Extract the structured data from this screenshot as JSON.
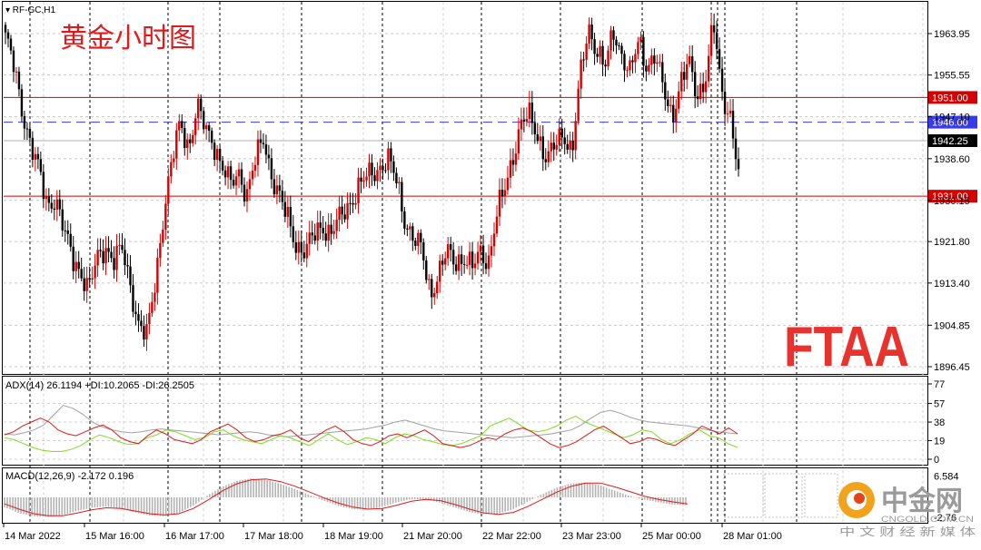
{
  "window": {
    "symbol": "RF-GC,H1",
    "caption": "黄金小时图"
  },
  "watermark": {
    "brand": "FTAA",
    "brand_color": "#e8322e",
    "site_name": "中金网",
    "site_domain": "CNGOLD.COM.CN",
    "site_tagline": "中 文 财 经 新 媒 体"
  },
  "colors": {
    "bull": "#d60000",
    "bear": "#000000",
    "level_line": "#d60000",
    "dashed_line": "#3a3ae6",
    "adx": "#a0a0a0",
    "plus_di": "#7ddc1f",
    "minus_di": "#e0191a",
    "macd_hist": "#b4b4b4",
    "macd_signal": "#e0191a"
  },
  "chart_data": [
    {
      "type": "candlestick",
      "title": "黄金小时图",
      "ylim": [
        1893,
        1971
      ],
      "y_ticks": [
        "1963.95",
        "1955.55",
        "1947.10",
        "1938.60",
        "1930.15",
        "1921.80",
        "1913.40",
        "1904.85",
        "1896.45"
      ],
      "x_ticks": [
        "14 Mar 2022",
        "15 Mar 16:00",
        "16 Mar 17:00",
        "17 Mar 18:00",
        "18 Mar 19:00",
        "21 Mar 20:00",
        "22 Mar 22:00",
        "23 Mar 23:00",
        "25 Mar 00:00",
        "28 Mar 01:00"
      ],
      "price_anchors": [
        1963.5,
        1957,
        1948.5,
        1942,
        1936,
        1929,
        1931,
        1924,
        1918.5,
        1916,
        1912,
        1918,
        1921,
        1918,
        1920,
        1913,
        1905,
        1902.5,
        1914,
        1928,
        1938,
        1946,
        1941,
        1949,
        1944.5,
        1942,
        1937,
        1933,
        1936,
        1931.5,
        1938,
        1943,
        1935,
        1930,
        1926,
        1921,
        1919.5,
        1923,
        1925.5,
        1923,
        1926,
        1929,
        1931.5,
        1934,
        1936,
        1937,
        1938,
        1934,
        1926,
        1922,
        1920,
        1911.5,
        1915,
        1919.5,
        1918,
        1918.5,
        1916,
        1920,
        1918,
        1927,
        1933,
        1940,
        1946,
        1947,
        1943,
        1938.5,
        1941,
        1944,
        1940,
        1955,
        1965,
        1961,
        1957,
        1964,
        1960,
        1956,
        1962,
        1957.5,
        1960,
        1952,
        1947,
        1954,
        1958,
        1951,
        1955,
        1966,
        1951,
        1948,
        1936
      ],
      "levels": [
        {
          "label": "1951.00",
          "value": 1951.0,
          "style": "solid",
          "color": "#d60000"
        },
        {
          "label": "1946.00",
          "value": 1946.0,
          "style": "dashed",
          "color": "#3a3ae6"
        },
        {
          "label": "1942.25",
          "value": 1942.25,
          "style": "current",
          "color": "#000000"
        },
        {
          "label": "1931.00",
          "value": 1931.0,
          "style": "solid",
          "color": "#d60000"
        }
      ]
    },
    {
      "type": "line",
      "indicator": "ADX(14)",
      "title": "ADX(14) 26.1194 +DI:10.2065 -DI:26.2505",
      "ylim": [
        0,
        77
      ],
      "y_ticks": [
        "77",
        "57",
        "38",
        "19",
        "0"
      ],
      "series": [
        {
          "name": "ADX",
          "last": 26.1194,
          "values": [
            26,
            25,
            27,
            30,
            35,
            45,
            55,
            52,
            46,
            38,
            33,
            30,
            28,
            27,
            28,
            30,
            31,
            30,
            29,
            28,
            27,
            26,
            25,
            26,
            27,
            28,
            27,
            25,
            24,
            23,
            24,
            25,
            26,
            27,
            28,
            29,
            30,
            31,
            33,
            35,
            38,
            40,
            37,
            34,
            31,
            29,
            28,
            27,
            26,
            25,
            24,
            23,
            22,
            23,
            24,
            25,
            26,
            28,
            30,
            35,
            42,
            48,
            50,
            47,
            43,
            40,
            38,
            37,
            36,
            35,
            34,
            32,
            30,
            28,
            27,
            26
          ]
        },
        {
          "name": "+DI",
          "last": 10.2065,
          "values": [
            22,
            20,
            16,
            12,
            9,
            8,
            8,
            10,
            14,
            20,
            25,
            22,
            18,
            15,
            16,
            22,
            25,
            30,
            28,
            24,
            20,
            22,
            28,
            30,
            24,
            20,
            18,
            16,
            20,
            24,
            22,
            18,
            14,
            20,
            26,
            20,
            15,
            18,
            22,
            20,
            16,
            22,
            26,
            24,
            20,
            18,
            15,
            14,
            16,
            20,
            24,
            34,
            38,
            42,
            36,
            30,
            28,
            30,
            34,
            40,
            44,
            38,
            34,
            30,
            26,
            22,
            25,
            30,
            28,
            20,
            16,
            20,
            26,
            30,
            24,
            22,
            16,
            12
          ]
        },
        {
          "name": "-DI",
          "last": 26.2505,
          "values": [
            25,
            28,
            34,
            38,
            42,
            38,
            30,
            26,
            24,
            28,
            32,
            35,
            30,
            22,
            18,
            16,
            24,
            30,
            26,
            20,
            18,
            16,
            20,
            28,
            32,
            36,
            30,
            22,
            18,
            20,
            24,
            26,
            30,
            22,
            18,
            24,
            30,
            34,
            28,
            20,
            16,
            14,
            18,
            24,
            26,
            22,
            26,
            30,
            24,
            16,
            14,
            12,
            14,
            18,
            22,
            20,
            26,
            30,
            32,
            28,
            22,
            16,
            12,
            14,
            18,
            24,
            30,
            34,
            28,
            22,
            16,
            18,
            22,
            20,
            16,
            14,
            20,
            26,
            34,
            30,
            26,
            32,
            26
          ]
        }
      ]
    },
    {
      "type": "bar",
      "indicator": "MACD(12,26,9)",
      "title": "MACD(12,26,9) -2.172 0.196",
      "ylim": [
        -2.76,
        6.584
      ],
      "y_ticks": [
        "6.584",
        "-2.76"
      ],
      "series": [
        {
          "name": "MACD",
          "last": -2.172,
          "values": [
            -3,
            -4.8,
            -5.8,
            -6,
            -5.4,
            -4.2,
            -3.2,
            -2.8,
            -3.4,
            -4.6,
            -5.6,
            -5.8,
            -4.8,
            -2.6,
            0.6,
            3.2,
            5.0,
            5.8,
            5.4,
            4.2,
            2.6,
            0.8,
            -1.0,
            -2.6,
            -3.6,
            -3.8,
            -3.0,
            -1.6,
            -0.6,
            -0.6,
            -1.6,
            -3.0,
            -4.4,
            -5.2,
            -5.0,
            -3.8,
            -1.6,
            0.8,
            2.8,
            4.2,
            4.6,
            3.8,
            2.2,
            0.6,
            -0.6,
            -1.4,
            -2.2,
            -2.4
          ]
        },
        {
          "name": "Signal",
          "last": 0.196,
          "values": [
            -2.0,
            -3.6,
            -5.0,
            -5.6,
            -5.6,
            -4.8,
            -3.8,
            -3.2,
            -3.4,
            -4.2,
            -5.0,
            -5.4,
            -5.0,
            -3.4,
            -0.8,
            2.0,
            4.2,
            5.4,
            5.6,
            4.8,
            3.4,
            1.6,
            -0.2,
            -1.8,
            -3.0,
            -3.6,
            -3.4,
            -2.4,
            -1.2,
            -0.6,
            -1.0,
            -2.2,
            -3.6,
            -4.8,
            -5.2,
            -4.6,
            -2.8,
            -0.6,
            1.6,
            3.4,
            4.4,
            4.4,
            3.2,
            1.8,
            0.4,
            -0.6,
            -1.4,
            -2.0
          ]
        }
      ]
    }
  ]
}
